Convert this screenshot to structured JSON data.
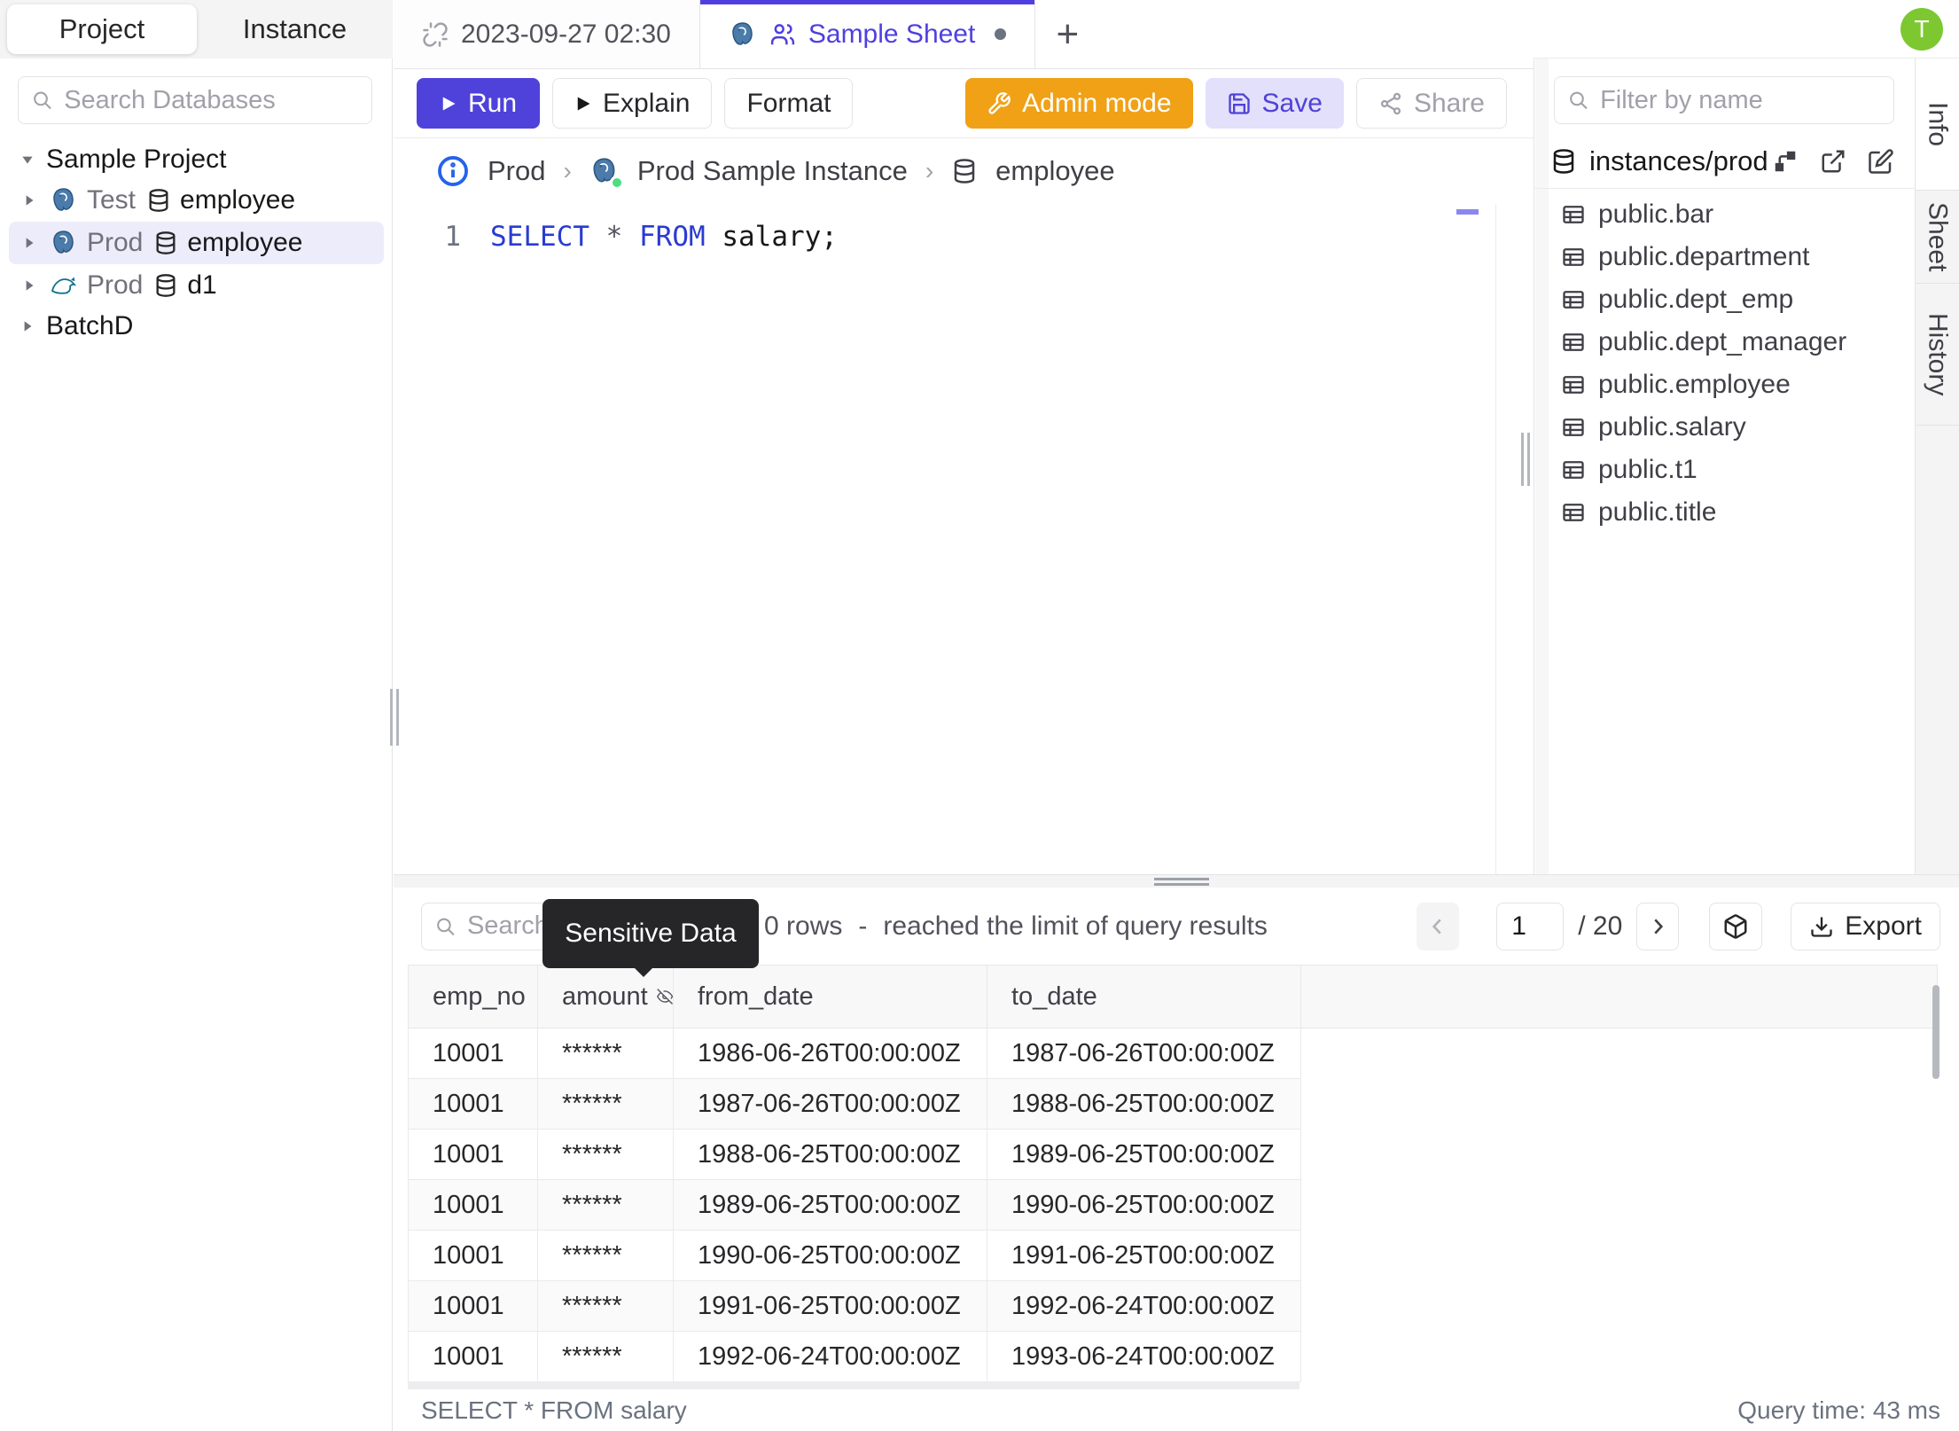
{
  "sidebar": {
    "tabs": [
      {
        "label": "Project"
      },
      {
        "label": "Instance"
      }
    ],
    "search_placeholder": "Search Databases",
    "groups": {
      "project": "Sample Project",
      "batch": "BatchD"
    },
    "tree": [
      {
        "env": "Test",
        "db": "employee",
        "engine": "postgres"
      },
      {
        "env": "Prod",
        "db": "employee",
        "engine": "postgres"
      },
      {
        "env": "Prod",
        "db": "d1",
        "engine": "mysql"
      }
    ]
  },
  "tabbar": {
    "tab1": "2023-09-27 02:30",
    "tab2": "Sample Sheet",
    "add": "+"
  },
  "toolbar": {
    "run": "Run",
    "explain": "Explain",
    "format": "Format",
    "admin": "Admin mode",
    "save": "Save",
    "share": "Share"
  },
  "breadcrumb": {
    "environment": "Prod",
    "instance": "Prod Sample Instance",
    "database": "employee"
  },
  "editor": {
    "line_number": "1",
    "kw_select": "SELECT",
    "star": "*",
    "kw_from": "FROM",
    "rest": "salary;"
  },
  "right_panel": {
    "filter_placeholder": "Filter by name",
    "connection": "instances/prod",
    "tables": [
      "public.bar",
      "public.department",
      "public.dept_emp",
      "public.dept_manager",
      "public.employee",
      "public.salary",
      "public.t1",
      "public.title"
    ],
    "side_tabs": [
      "Info",
      "Sheet",
      "History"
    ]
  },
  "results": {
    "search_placeholder": "Search",
    "tooltip": "Sensitive Data",
    "rows_count": "0 rows",
    "dash": "-",
    "limit_note": "reached the limit of query results",
    "page": "1",
    "page_total": "/ 20",
    "export": "Export",
    "columns": [
      "emp_no",
      "amount",
      "from_date",
      "to_date"
    ],
    "rows": [
      [
        "10001",
        "******",
        "1986-06-26T00:00:00Z",
        "1987-06-26T00:00:00Z"
      ],
      [
        "10001",
        "******",
        "1987-06-26T00:00:00Z",
        "1988-06-25T00:00:00Z"
      ],
      [
        "10001",
        "******",
        "1988-06-25T00:00:00Z",
        "1989-06-25T00:00:00Z"
      ],
      [
        "10001",
        "******",
        "1989-06-25T00:00:00Z",
        "1990-06-25T00:00:00Z"
      ],
      [
        "10001",
        "******",
        "1990-06-25T00:00:00Z",
        "1991-06-25T00:00:00Z"
      ],
      [
        "10001",
        "******",
        "1991-06-25T00:00:00Z",
        "1992-06-24T00:00:00Z"
      ],
      [
        "10001",
        "******",
        "1992-06-24T00:00:00Z",
        "1993-06-24T00:00:00Z"
      ]
    ],
    "status_left": "SELECT * FROM salary",
    "status_right": "Query time: 43 ms"
  },
  "user": {
    "initial": "T"
  },
  "colors": {
    "accent": "#4f42da",
    "admin_orange": "#f0a116",
    "avatar_green": "#7dc831",
    "status_green": "#4ade80",
    "postgres_blue": "#4b7bab",
    "mysql_teal": "#11718d"
  }
}
